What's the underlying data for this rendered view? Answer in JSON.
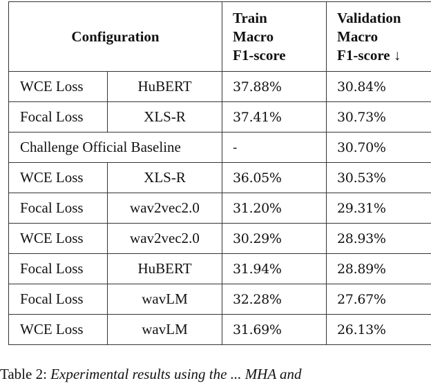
{
  "table": {
    "headers": {
      "configuration": "Configuration",
      "train": [
        "Train",
        "Macro",
        "F1-score"
      ],
      "validation": [
        "Validation",
        "Macro",
        "F1-score ↓"
      ]
    },
    "rows": [
      {
        "loss": "WCE Loss",
        "model": "HuBERT",
        "train": "37.88%",
        "validation": "30.84%"
      },
      {
        "loss": "Focal Loss",
        "model": "XLS-R",
        "train": "37.41%",
        "validation": "30.73%"
      },
      {
        "config_span": "Challenge Official Baseline",
        "train": "-",
        "validation": "30.70%"
      },
      {
        "loss": "WCE Loss",
        "model": "XLS-R",
        "train": "36.05%",
        "validation": "30.53%"
      },
      {
        "loss": "Focal Loss",
        "model": "wav2vec2.0",
        "train": "31.20%",
        "validation": "29.31%"
      },
      {
        "loss": "WCE Loss",
        "model": "wav2vec2.0",
        "train": "30.29%",
        "validation": "28.93%"
      },
      {
        "loss": "Focal Loss",
        "model": "HuBERT",
        "train": "31.94%",
        "validation": "28.89%"
      },
      {
        "loss": "Focal Loss",
        "model": "wavLM",
        "train": "32.28%",
        "validation": "27.67%"
      },
      {
        "loss": "WCE Loss",
        "model": "wavLM",
        "train": "31.69%",
        "validation": "26.13%"
      }
    ]
  },
  "caption": {
    "label": "Table 2:",
    "text": "Experimental results using the ... MHA and"
  }
}
